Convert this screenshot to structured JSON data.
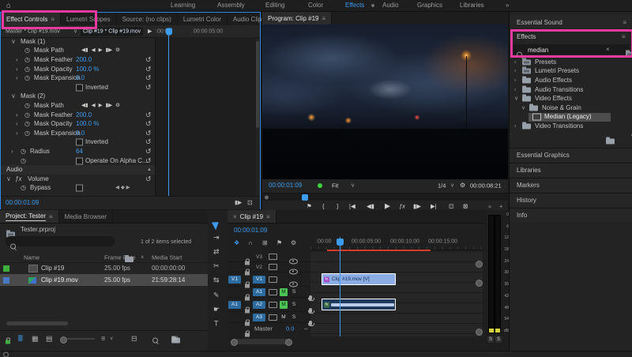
{
  "icons": {
    "home": "⌂",
    "menu": "≡",
    "overflow": "»",
    "chevron_down": "∨",
    "chevron_right": "›",
    "chevron_up": "∧",
    "collapse_up": "▲",
    "stopwatch": "◷",
    "reset": "↺",
    "track_back1": "◀▮",
    "track_back": "◀",
    "track_fwd": "▶",
    "track_fwd1": "▮▶",
    "wrench": "⚙",
    "kf_prev": "◀",
    "kf_add": "◆",
    "kf_next": "▶",
    "play": "▶",
    "marker": "⚑",
    "mark_in": "{",
    "mark_out": "}",
    "goto_in": "|◀",
    "step_back": "◀▮",
    "fx": "ƒx",
    "step_fwd": "▮▶",
    "goto_out": "▶|",
    "lift": "⊡",
    "extract": "⊠",
    "plus": "+",
    "close": "×",
    "snap": "∩",
    "nest": "❖",
    "linked": "⊞",
    "fit_arrows": "↔",
    "tool_track_select": "⇥",
    "tool_ripple": "⇄",
    "tool_razor": "✂",
    "tool_slip": "⇆",
    "tool_pen": "✎",
    "tool_hand": "☛",
    "tool_type": "T",
    "list_view": "≣",
    "icon_view": "▦",
    "freeform_view": "▤",
    "sort": "≡",
    "new_item": "▣",
    "automate": "⊟",
    "export_frame": "⊡",
    "play_edit": "▶"
  },
  "menubar": {
    "items": [
      "Learning",
      "Assembly",
      "Editing",
      "Color",
      "Effects",
      "Audio",
      "Graphics",
      "Libraries"
    ],
    "active": "Effects"
  },
  "left_tabs": {
    "tab1": "Effect Controls",
    "tab2": "Lumetri Scopes",
    "tab3": "Source: (no clips)",
    "tab4": "Lumetri Color",
    "tab5": "Audio Clip Mi",
    "active": "Effect Controls"
  },
  "effect_controls": {
    "master": "Master * Clip #19.mov",
    "clip": "Clip #19 * Clip #19.mov",
    "ruler_partial": ":00:00",
    "ruler_5s": "00:00:05:00",
    "timecode": "00:00:01:09",
    "rows": [
      {
        "label": "Mask (1)"
      },
      {
        "label": "Mask Path"
      },
      {
        "label": "Mask Feather",
        "value": "200.0"
      },
      {
        "label": "Mask Opacity",
        "value": "100.0 %"
      },
      {
        "label": "Mask Expansion",
        "value": "0.0"
      },
      {
        "label": "Inverted"
      },
      {
        "label": "Mask (2)"
      },
      {
        "label": "Mask Path"
      },
      {
        "label": "Mask Feather",
        "value": "200.0"
      },
      {
        "label": "Mask Opacity",
        "value": "100.0 %"
      },
      {
        "label": "Mask Expansion",
        "value": "0.0"
      },
      {
        "label": "Inverted"
      },
      {
        "label": "Radius",
        "value": "64"
      },
      {
        "label": "Operate On Alpha C..."
      },
      {
        "label": "Audio"
      },
      {
        "label": "Volume"
      },
      {
        "label": "Bypass"
      }
    ]
  },
  "program": {
    "tab": "Program: Clip #19",
    "timecode": "00:00:01:09",
    "zoom_level": "Fit",
    "playback_resolution": "1/4",
    "duration": "00:00:08:21"
  },
  "effects_panel": {
    "essential_sound": "Essential Sound",
    "title": "Effects",
    "search_value": "median",
    "tree": [
      {
        "label": "Presets"
      },
      {
        "label": "Lumetri Presets"
      },
      {
        "label": "Audio Effects"
      },
      {
        "label": "Audio Transitions"
      },
      {
        "label": "Video Effects"
      },
      {
        "label": "Noise & Grain"
      },
      {
        "label": "Median (Legacy)"
      },
      {
        "label": "Video Transitions"
      }
    ],
    "selected_item": "Median (Legacy)",
    "panels": [
      "Essential Graphics",
      "Libraries",
      "Markers",
      "History",
      "Info"
    ]
  },
  "project": {
    "tab1": "Project: Tester",
    "tab2": "Media Browser",
    "bin": "Tester.prproj",
    "selection": "1 of 2 items selected",
    "col_name": "Name",
    "col_fps": "Frame Rate",
    "col_start": "Media Start",
    "rows": [
      {
        "name": "Clip #19",
        "fps": "25.00 fps",
        "start": "00:00:00:00"
      },
      {
        "name": "Clip #19.mov",
        "fps": "25.00 fps",
        "start": "21:59:28:14"
      }
    ]
  },
  "timeline": {
    "tab": "Clip #19",
    "timecode": "00:00:01:09",
    "ruler_partial": ":00:00",
    "ruler": [
      "00:00:05:00",
      "00:00:10:00",
      "00:00:15:00"
    ],
    "video_tracks": [
      "V3",
      "V2",
      "V1"
    ],
    "audio_tracks": [
      "A1",
      "A2",
      "A3"
    ],
    "source_video": "V1",
    "source_audio": "A1",
    "master_label": "Master",
    "master_value": "0.0",
    "video_clip": "Clip #19.mov [V]",
    "fx_badge": "fx",
    "mute": "M",
    "solo": "S"
  },
  "meters": {
    "scale": [
      "0",
      "6",
      "12",
      "18",
      "24",
      "30",
      "36",
      "42",
      "48",
      "54"
    ],
    "db": "dB",
    "solo": "S"
  },
  "colors": {
    "accent_blue": "#3c9df0",
    "focus_border": "#2d8ceb",
    "annotation_pink": "#e8399f",
    "mute_green": "#4cc455",
    "video_clip": "#8bade4",
    "audio_clip": "#1e3b5c"
  }
}
